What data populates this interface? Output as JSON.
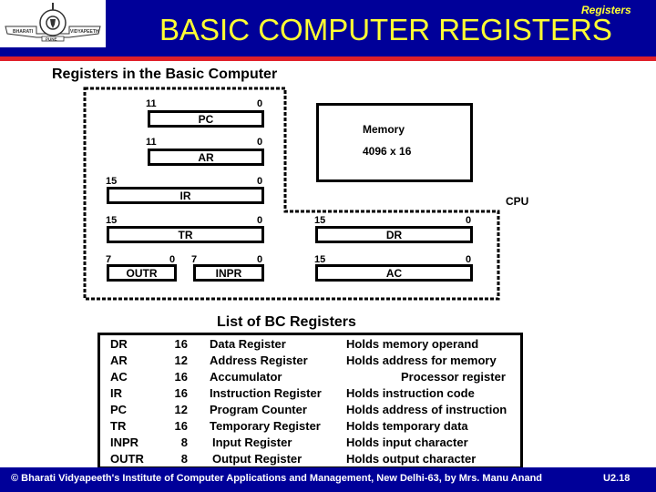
{
  "header": {
    "title": "BASIC COMPUTER  REGISTERS",
    "corner_tag": "Registers",
    "logo": {
      "left_text": "BHARATI",
      "right_text": "VIDYAPEETH",
      "bottom_text": "PUNE"
    }
  },
  "diagram": {
    "subtitle": "Registers in the Basic Computer",
    "cpu_label": "CPU",
    "memory": {
      "label": "Memory",
      "size": "4096 x 16"
    },
    "registers": [
      {
        "name": "PC",
        "high_bit": "11",
        "low_bit": "0"
      },
      {
        "name": "AR",
        "high_bit": "11",
        "low_bit": "0"
      },
      {
        "name": "IR",
        "high_bit": "15",
        "low_bit": "0"
      },
      {
        "name": "TR",
        "high_bit": "15",
        "low_bit": "0"
      },
      {
        "name": "DR",
        "high_bit": "15",
        "low_bit": "0"
      },
      {
        "name": "OUTR",
        "high_bit": "7",
        "low_bit": "0"
      },
      {
        "name": "INPR",
        "high_bit": "7",
        "low_bit": "0"
      },
      {
        "name": "AC",
        "high_bit": "15",
        "low_bit": "0"
      }
    ]
  },
  "register_list": {
    "title": "List of BC Registers",
    "rows": [
      {
        "name": "DR",
        "bits": "16",
        "full_name": "Data Register",
        "description": "Holds memory operand"
      },
      {
        "name": "AR",
        "bits": "12",
        "full_name": "Address Register",
        "description": "Holds address for memory"
      },
      {
        "name": "AC",
        "bits": "16",
        "full_name": "Accumulator",
        "description": "Processor register"
      },
      {
        "name": "IR",
        "bits": "16",
        "full_name": "Instruction Register",
        "description": "Holds instruction code"
      },
      {
        "name": "PC",
        "bits": "12",
        "full_name": "Program Counter",
        "description": "Holds address of instruction"
      },
      {
        "name": "TR",
        "bits": "16",
        "full_name": "Temporary Register",
        "description": "Holds temporary data"
      },
      {
        "name": "INPR",
        "bits": "8",
        "full_name": "Input Register",
        "description": "Holds input character"
      },
      {
        "name": "OUTR",
        "bits": "8",
        "full_name": "Output Register",
        "description": "Holds output character"
      }
    ]
  },
  "footer": {
    "text": "© Bharati Vidyapeeth's Institute of Computer Applications and Management, New Delhi-63, by Mrs. Manu Anand",
    "page": "U2.18"
  },
  "colors": {
    "header_bg": "#000099",
    "header_stripe": "#e0202a",
    "title_text": "#ffff33",
    "footer_bg": "#000099"
  }
}
